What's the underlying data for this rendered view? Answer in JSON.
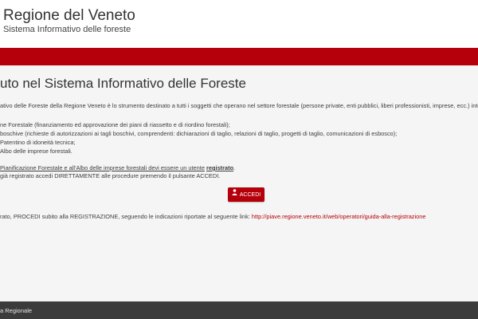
{
  "header": {
    "title": "Regione del Veneto",
    "subtitle": "Sistema Informativo delle foreste"
  },
  "main": {
    "heading": "uto nel Sistema Informativo delle Foreste",
    "intro": "ativo delle Foreste della Regione Veneto è lo strumento destinato a tutti i soggetti che operano nel settore forestale (persone private, enti pubblici, liberi professionisti, imprese, ecc.) interessati",
    "items": [
      "ne Forestale (finanziamento ed approvazione dei piani di riassetto e di riordino forestali);",
      "boschive (richieste di autorizzazioni ai tagli boschivi, comprendenti: dichiarazioni di taglio, relazioni di taglio, progetti di taglio, comunicazioni di esbosco);",
      "Patentino di idoneità tecnica;",
      "Albo delle imprese forestali."
    ],
    "registration_note": {
      "underlined_text": "Pianificazione Forestale e all'Albo delle imprese forestali devi essere un utente",
      "bold_text": "registrato",
      "end": "."
    },
    "already_registered": "già registrato accedi DIRETTAMENTE alle procedure premendo il pulsante ACCEDI.",
    "accedi_label": "ACCEDI",
    "not_registered": {
      "text": "rato, PROCEDI subito alla REGISTRAZIONE, seguendo le indicazioni riportate al seguente link:",
      "link": "http://piave.regione.veneto.it/web/operatori/guida-alla-registrazione"
    }
  },
  "footer": {
    "text": "a Regionale"
  },
  "colors": {
    "brand_red": "#b5000c",
    "footer_bg": "#3b3b3b",
    "content_bg": "#f5f5f5"
  },
  "icons": {
    "accedi_button": "user-lock-icon"
  }
}
